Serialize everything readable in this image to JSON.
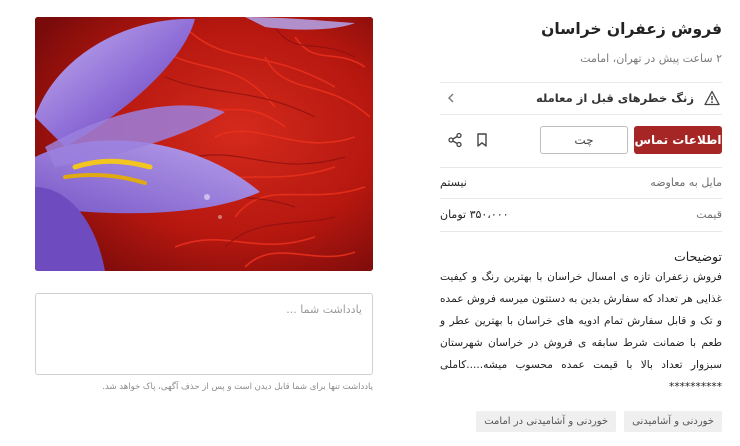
{
  "listing": {
    "title": "فروش زعفران خراسان",
    "subtitle": "۲ ساعت پیش در تهران، امامت"
  },
  "warning": {
    "text": "زنگ خطرهای قبل از معامله",
    "icon": "warning-triangle-icon"
  },
  "actions": {
    "contact_label": "اطلاعات تماس",
    "chat_label": "چت",
    "bookmark_icon": "bookmark-icon",
    "share_icon": "share-icon",
    "accent_color": "#a62626"
  },
  "details": [
    {
      "key": "مایل به معاوضه",
      "value": "نیستم"
    },
    {
      "key": "قیمت",
      "value": "۳۵۰،۰۰۰ تومان"
    }
  ],
  "description": {
    "heading": "توضیحات",
    "body": "فروش زعفران تازه ی امسال خراسان با بهترین رنگ و کیفیت غذایی هر تعداد که سفارش بدین به دستتون میرسه فروش عمده و تک و قابل سفارش تمام ادویه های خراسان با بهترین عطر و طعم با ضمانت شرط سابقه ی فروش در خراسان شهرستان سبزوار تعداد بالا با قیمت عمده محسوب میشه.....کاملی **********"
  },
  "tags": [
    "خوردنی و آشامیدنی",
    "خوردنی و آشامیدنی در امامت"
  ],
  "note": {
    "placeholder": "یادداشت شما ...",
    "hint": "یادداشت تنها برای شما قابل دیدن است و پس از حذف آگهی، پاک خواهد شد."
  },
  "photo": {
    "subject": "saffron-crocus-photo"
  }
}
